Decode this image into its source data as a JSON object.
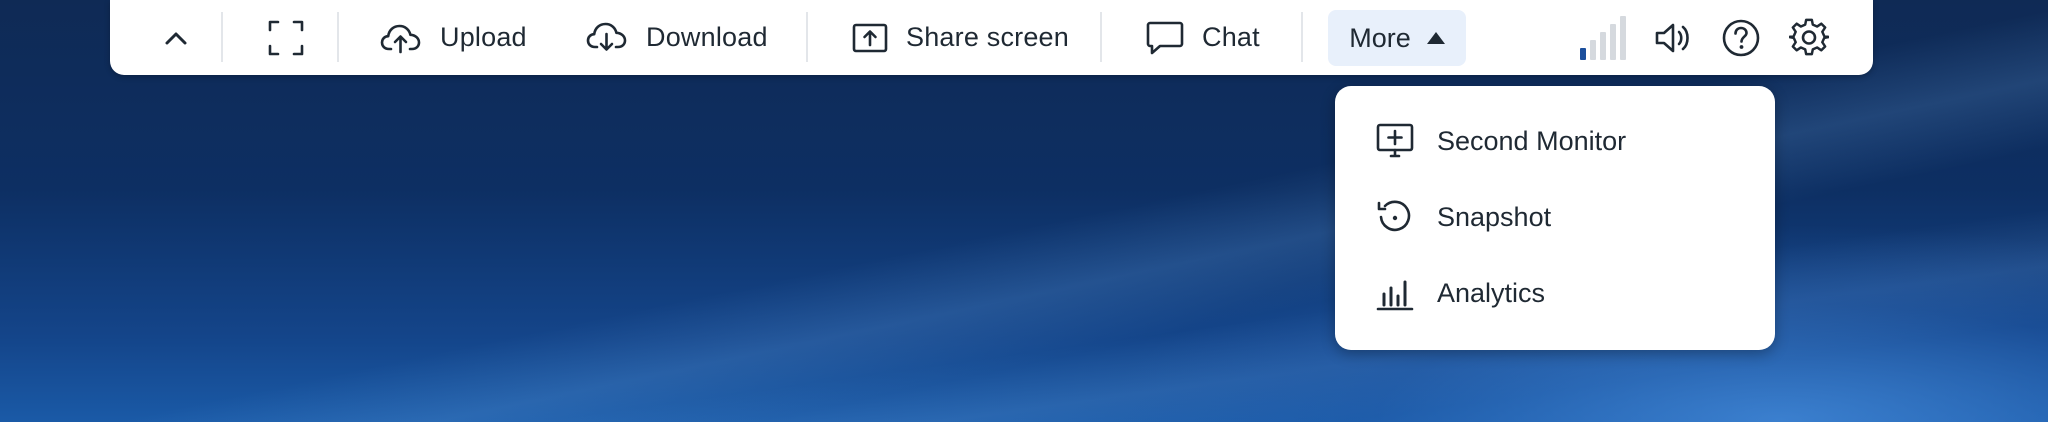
{
  "toolbar": {
    "upload_label": "Upload",
    "download_label": "Download",
    "share_label": "Share screen",
    "chat_label": "Chat",
    "more_label": "More"
  },
  "more_menu": {
    "items": [
      {
        "label": "Second Monitor",
        "icon": "monitor-plus-icon"
      },
      {
        "label": "Snapshot",
        "icon": "snapshot-icon"
      },
      {
        "label": "Analytics",
        "icon": "analytics-icon"
      }
    ]
  },
  "signal_strength": {
    "bars_active": 1,
    "bars_total": 5
  },
  "colors": {
    "accent": "#1b4f9c",
    "toolbar_bg": "#ffffff",
    "more_active_bg": "#e8f0fb",
    "text": "#1f2933"
  }
}
